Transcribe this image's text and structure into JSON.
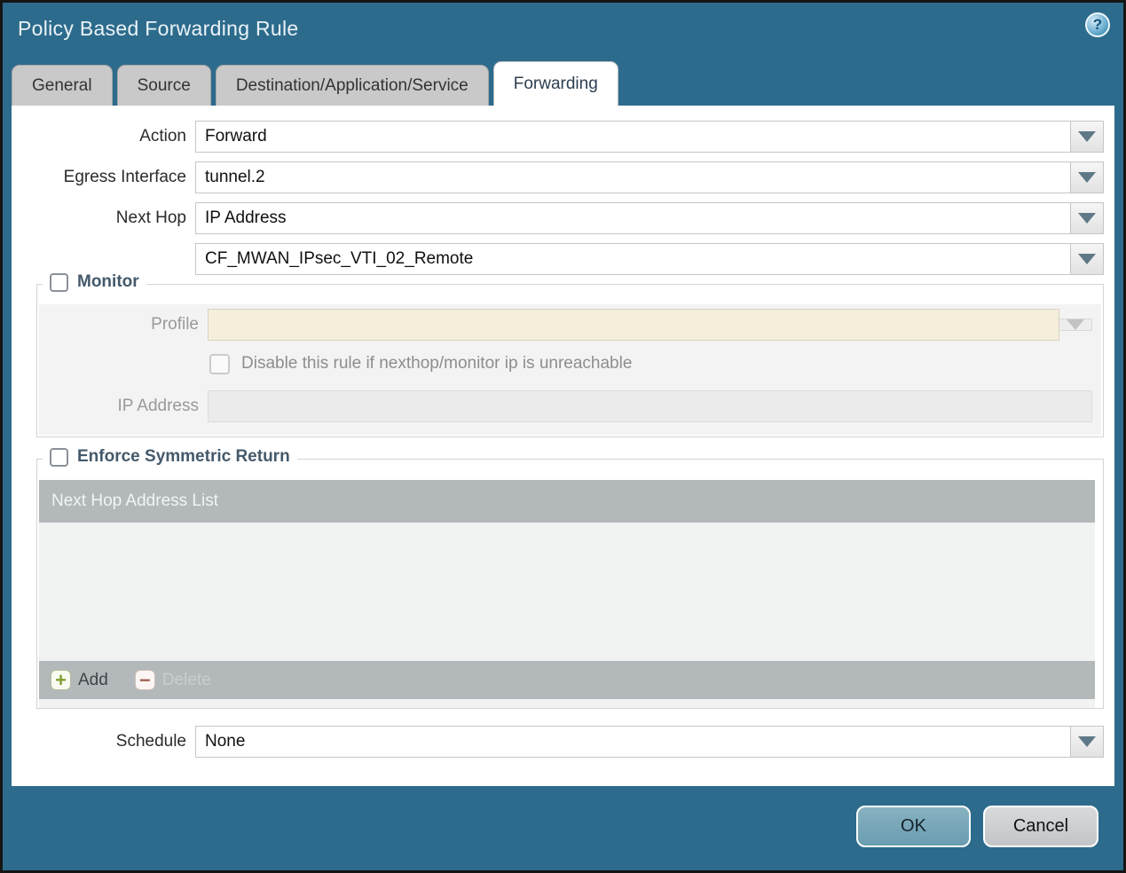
{
  "window": {
    "title": "Policy Based Forwarding Rule"
  },
  "icons": {
    "help": "?",
    "add": "+",
    "delete": "−"
  },
  "tabs": [
    {
      "label": "General",
      "active": false
    },
    {
      "label": "Source",
      "active": false
    },
    {
      "label": "Destination/Application/Service",
      "active": false
    },
    {
      "label": "Forwarding",
      "active": true
    }
  ],
  "form": {
    "action": {
      "label": "Action",
      "value": "Forward"
    },
    "egress_interface": {
      "label": "Egress Interface",
      "value": "tunnel.2"
    },
    "next_hop": {
      "label": "Next Hop",
      "value": "IP Address"
    },
    "next_hop_address": {
      "value": "CF_MWAN_IPsec_VTI_02_Remote"
    },
    "schedule": {
      "label": "Schedule",
      "value": "None"
    }
  },
  "monitor": {
    "legend": "Monitor",
    "checked": false,
    "profile": {
      "label": "Profile",
      "value": ""
    },
    "disable_rule": {
      "label": "Disable this rule if nexthop/monitor ip is unreachable",
      "checked": false
    },
    "ip_address": {
      "label": "IP Address",
      "value": ""
    }
  },
  "enforce_symmetric_return": {
    "legend": "Enforce Symmetric Return",
    "checked": false,
    "table": {
      "header": "Next Hop Address List",
      "rows": []
    },
    "toolbar": {
      "add": "Add",
      "delete": "Delete"
    }
  },
  "footer": {
    "ok": "OK",
    "cancel": "Cancel"
  },
  "colors": {
    "titlebar": "#2d6b8c",
    "tab_inactive": "#c9c9c9",
    "tab_active": "#ffffff",
    "legend_text": "#44596b",
    "table_header": "#b3b8bb",
    "table_body": "#f1f2f2",
    "monitor_panel": "#f3f3f3",
    "profile_field": "#f5eedb",
    "ok_button": "#74a5b7",
    "cancel_button": "#c9cccd"
  }
}
